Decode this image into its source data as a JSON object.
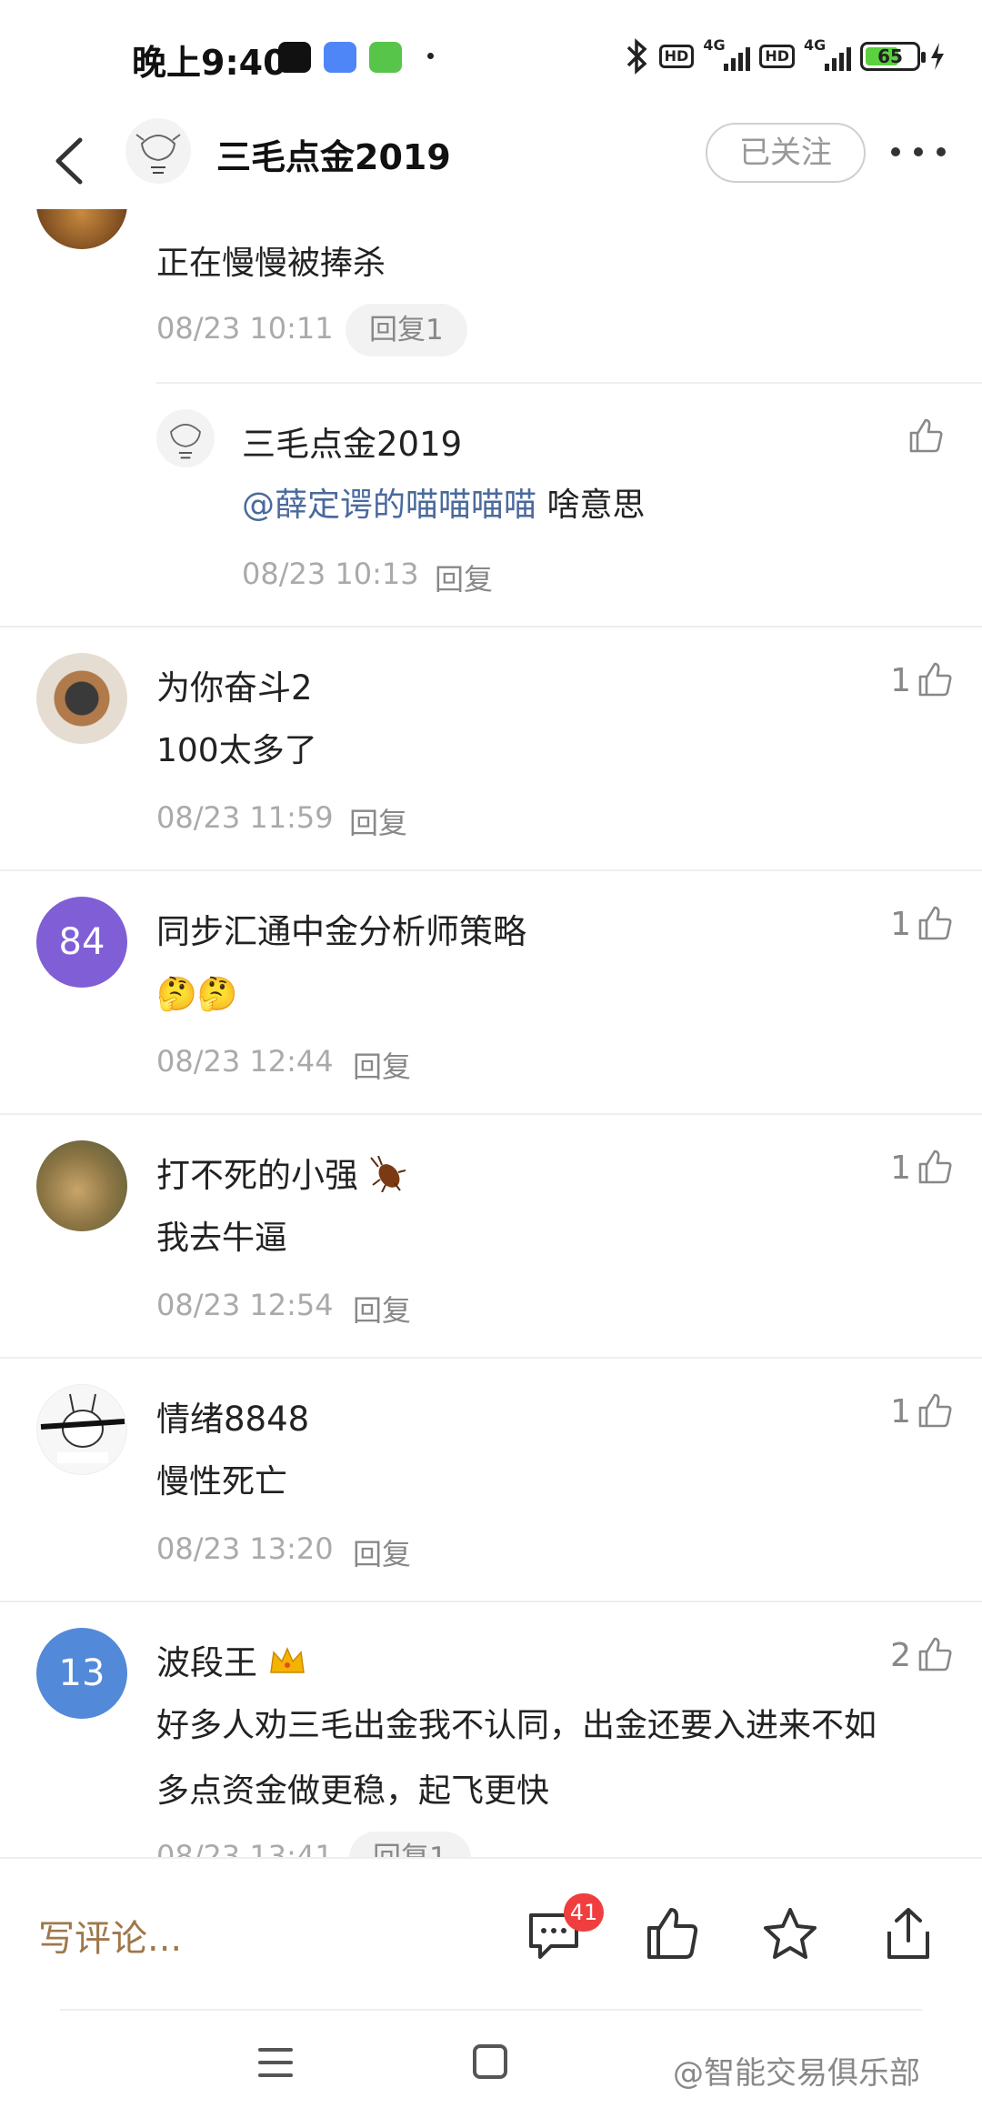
{
  "status_bar": {
    "time": "晚上9:40",
    "hd1": "HD",
    "net1": "4G",
    "hd2": "HD",
    "net2": "4G",
    "battery": "65"
  },
  "header": {
    "title": "三毛点金2019",
    "follow_label": "已关注"
  },
  "comments": [
    {
      "body": "正在慢慢被捧杀",
      "time": "08/23 10:11",
      "reply_label": "回复1",
      "sub_reply": {
        "name": "三毛点金2019",
        "mention": "@薛定谔的喵喵喵喵",
        "text": "啥意思",
        "time": "08/23 10:13",
        "reply_label": "回复"
      }
    },
    {
      "name": "为你奋斗2",
      "body": "100太多了",
      "time": "08/23 11:59",
      "reply_label": "回复",
      "likes": "1"
    },
    {
      "name": "同步汇通中金分析师策略",
      "avatar_text": "84",
      "body": "🤔🤔",
      "time": "08/23 12:44",
      "reply_label": "回复",
      "likes": "1"
    },
    {
      "name": "打不死的小强",
      "body": "我去牛逼",
      "time": "08/23 12:54",
      "reply_label": "回复",
      "likes": "1"
    },
    {
      "name": "情绪8848",
      "body": "慢性死亡",
      "time": "08/23 13:20",
      "reply_label": "回复",
      "likes": "1"
    },
    {
      "name": "波段王",
      "avatar_text": "13",
      "body_line1": "好多人劝三毛出金我不认同，出金还要入进来不如",
      "body_line2": "多点资金做更稳，起飞更快",
      "time": "08/23 13:41",
      "reply_label": "回复1",
      "likes": "2"
    }
  ],
  "bottom_bar": {
    "write_placeholder": "写评论...",
    "comment_count": "41"
  },
  "watermark": "@智能交易俱乐部",
  "colors": {
    "accent_brown": "#a0774a",
    "mention_blue": "#4a6a9c",
    "avatar_purple": "#7f5ed6",
    "avatar_blue": "#5389d9",
    "badge_red": "#f03e3e"
  }
}
